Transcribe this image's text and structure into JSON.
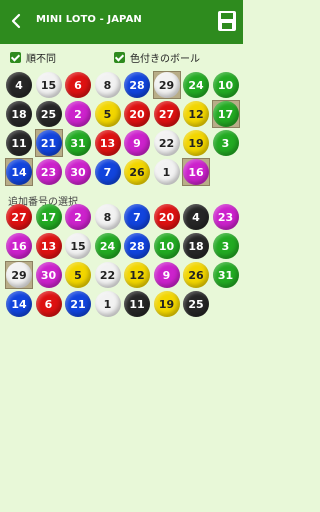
{
  "header": {
    "title": "MINI LOTO - JAPAN",
    "back_icon": "back-arrow-icon",
    "save_icon": "save-icon"
  },
  "options": [
    {
      "label": "順不同",
      "checked": true
    },
    {
      "label": "色付きのボール",
      "checked": true
    }
  ],
  "colors": {
    "1": "#f2f2f2",
    "2": "#cc22cc",
    "3": "#22aa22",
    "4": "#262626",
    "5": "#f2d600",
    "6": "#dd1111",
    "7": "#1144dd",
    "8": "#f2f2f2",
    "9": "#cc22cc",
    "10": "#22aa22",
    "11": "#262626",
    "12": "#f2d600",
    "13": "#dd1111",
    "14": "#1144dd",
    "15": "#f2f2f2",
    "16": "#cc22cc",
    "17": "#22aa22",
    "18": "#262626",
    "19": "#f2d600",
    "20": "#dd1111",
    "21": "#1144dd",
    "22": "#f2f2f2",
    "23": "#cc22cc",
    "24": "#22aa22",
    "25": "#262626",
    "26": "#f2d600",
    "27": "#dd1111",
    "28": "#1144dd",
    "29": "#f2f2f2",
    "30": "#cc22cc",
    "31": "#22aa22"
  },
  "main_grid": {
    "rows": [
      [
        4,
        15,
        6,
        8,
        28,
        29,
        24,
        10
      ],
      [
        18,
        25,
        2,
        5,
        20,
        27,
        12,
        17
      ],
      [
        11,
        21,
        31,
        13,
        9,
        22,
        19,
        3
      ],
      [
        14,
        23,
        30,
        7,
        26,
        1,
        16
      ]
    ],
    "selected": [
      29,
      17,
      21,
      14,
      16
    ]
  },
  "bonus_section": {
    "label": "追加番号の選択",
    "rows": [
      [
        27,
        17,
        2,
        8,
        7,
        20,
        4,
        23
      ],
      [
        16,
        13,
        15,
        24,
        28,
        10,
        18,
        3
      ],
      [
        29,
        30,
        5,
        22,
        12,
        9,
        26,
        31
      ],
      [
        14,
        6,
        21,
        1,
        11,
        19,
        25
      ]
    ],
    "selected": [
      29
    ]
  }
}
